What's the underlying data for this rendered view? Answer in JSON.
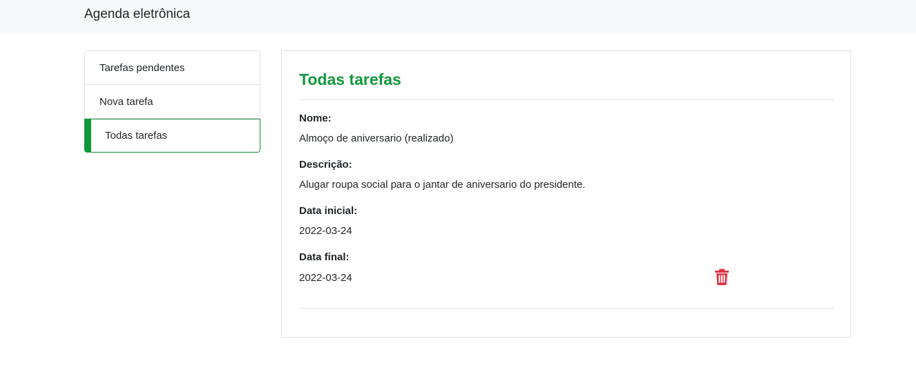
{
  "navbar": {
    "brand": "Agenda eletrônica"
  },
  "sidebar": {
    "items": [
      {
        "label": "Tarefas pendentes",
        "active": false
      },
      {
        "label": "Nova tarefa",
        "active": false
      },
      {
        "label": "Todas tarefas",
        "active": true
      }
    ]
  },
  "main": {
    "title": "Todas tarefas",
    "task": {
      "name_label": "Nome:",
      "name_value": "Almoço de aniversario (realizado)",
      "description_label": "Descrição:",
      "description_value": "Alugar roupa social para o jantar de aniversario do presidente.",
      "start_label": "Data inicial:",
      "start_value": "2022-03-24",
      "end_label": "Data final:",
      "end_value": "2022-03-24",
      "delete_icon": "trash-icon"
    }
  },
  "colors": {
    "accent": "#0e9a3a",
    "title": "#12993c",
    "danger": "#dc3545",
    "navbar_bg": "#f8f9fa"
  }
}
